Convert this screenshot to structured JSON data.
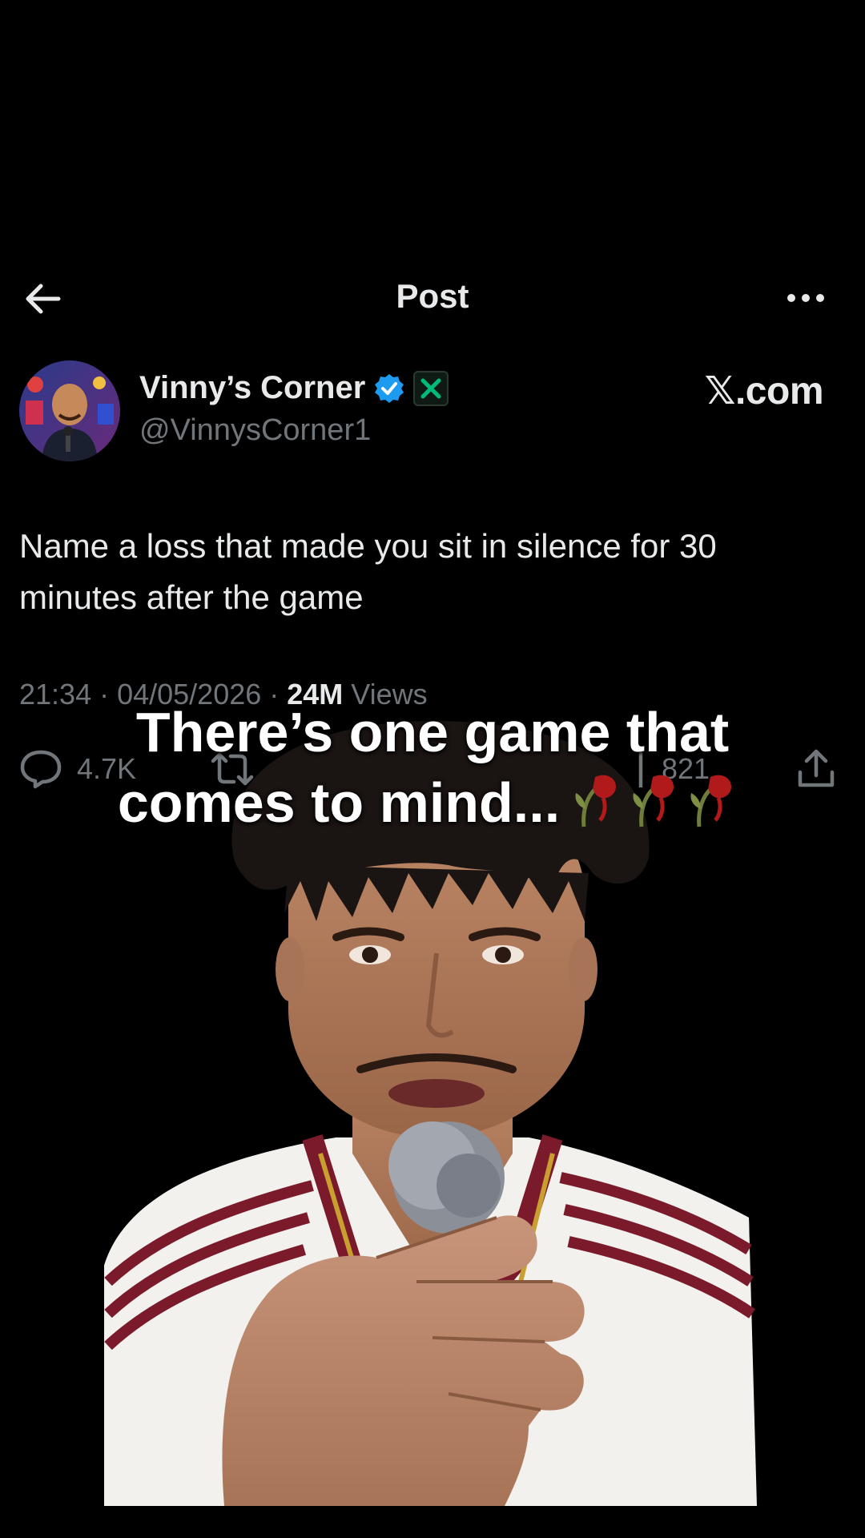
{
  "header": {
    "title": "Post",
    "back_icon": "arrow-left-icon",
    "more_icon": "more-horizontal-icon"
  },
  "author": {
    "name": "Vinny’s Corner",
    "handle": "@VinnysCorner1",
    "verified_icon": "verified-badge-icon",
    "affiliate_icon": "x-affiliate-icon",
    "verified_color": "#1d9bf0",
    "affiliate_color": "#00ba7c"
  },
  "watermark": "𝕏.com",
  "post": {
    "text": "Name a loss that made you sit in silence for 30 minutes after the game",
    "time": "21:34 · 04/05/2026 · ",
    "views_count": "24M",
    "views_label": " Views"
  },
  "actions": {
    "replies": "4.7K",
    "bookmarks": "821",
    "reply_icon": "reply-icon",
    "repost_icon": "repost-icon",
    "bookmark_icon": "bookmark-icon",
    "share_icon": "share-icon"
  },
  "caption": {
    "line1": "There’s one game that",
    "line2": "comes to mind...",
    "emoji_icon": "wilted-rose-icon"
  },
  "colors": {
    "background": "#000000",
    "text_primary": "#e7e9ea",
    "text_secondary": "#71767b",
    "jersey_stripe": "#7a1a2a"
  }
}
